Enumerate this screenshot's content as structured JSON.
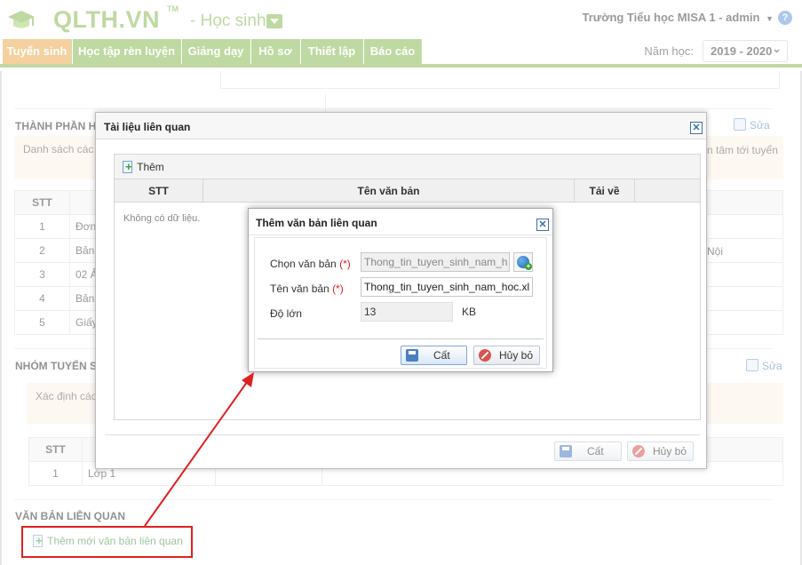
{
  "header": {
    "logo": "QLTH.VN",
    "logo_tm": "TM",
    "module": "- Học sinh",
    "school_user": "Trường Tiểu học MISA 1 - admin",
    "help": "?"
  },
  "nav": {
    "tabs": [
      {
        "label": "Tuyển sinh",
        "active": true
      },
      {
        "label": "Học tập rèn luyện",
        "active": false
      },
      {
        "label": "Giảng dạy",
        "active": false
      },
      {
        "label": "Hồ sơ",
        "active": false
      },
      {
        "label": "Thiết lập",
        "active": false
      },
      {
        "label": "Báo cáo",
        "active": false
      }
    ],
    "year_label": "Năm học:",
    "year_value": "2019 - 2020"
  },
  "page": {
    "section1_title": "THÀNH PHẦN H",
    "section1_edit": "Sửa",
    "section1_info": "Danh sách các g",
    "section1_info_right": "n tâm tới tuyển",
    "table1_header_stt": "STT",
    "table1_rows": [
      {
        "stt": "1",
        "text": "Đơn"
      },
      {
        "stt": "2",
        "text": "Bản s",
        "right": "Nội"
      },
      {
        "stt": "3",
        "text": "02 Ả"
      },
      {
        "stt": "4",
        "text": "Bản s"
      },
      {
        "stt": "5",
        "text": "Giấy"
      }
    ],
    "section2_title": "NHÓM TUYỂN S",
    "section2_edit": "Sửa",
    "section2_info": "Xác định các",
    "table2_header_stt": "STT",
    "table2_rows": [
      {
        "stt": "1",
        "text": "Lớp 1"
      }
    ],
    "section3_title": "VĂN BẢN LIÊN QUAN",
    "add_related_doc": "Thêm mới văn bản liên quan"
  },
  "dialog_docs": {
    "title": "Tài liệu liên quan",
    "add_label": "Thêm",
    "columns": [
      "STT",
      "Tên văn bản",
      "Tải về"
    ],
    "empty_text": "Không có dữ liệu.",
    "save_label": "Cất",
    "cancel_label": "Hủy bỏ"
  },
  "dialog_add": {
    "title": "Thêm văn bản liên quan",
    "choose_label": "Chọn văn bản",
    "name_label": "Tên văn bản",
    "required_mark": "(*)",
    "size_label": "Độ lớn",
    "choose_value": "Thong_tin_tuyen_sinh_nam_h",
    "name_value": "Thong_tin_tuyen_sinh_nam_hoc.xl",
    "size_value": "13",
    "size_unit": "KB",
    "save_label": "Cất",
    "cancel_label": "Hủy bỏ"
  },
  "colors": {
    "brand_green": "#7cb342",
    "active_tab": "#e8a33d",
    "annotation_red": "#e02020"
  }
}
